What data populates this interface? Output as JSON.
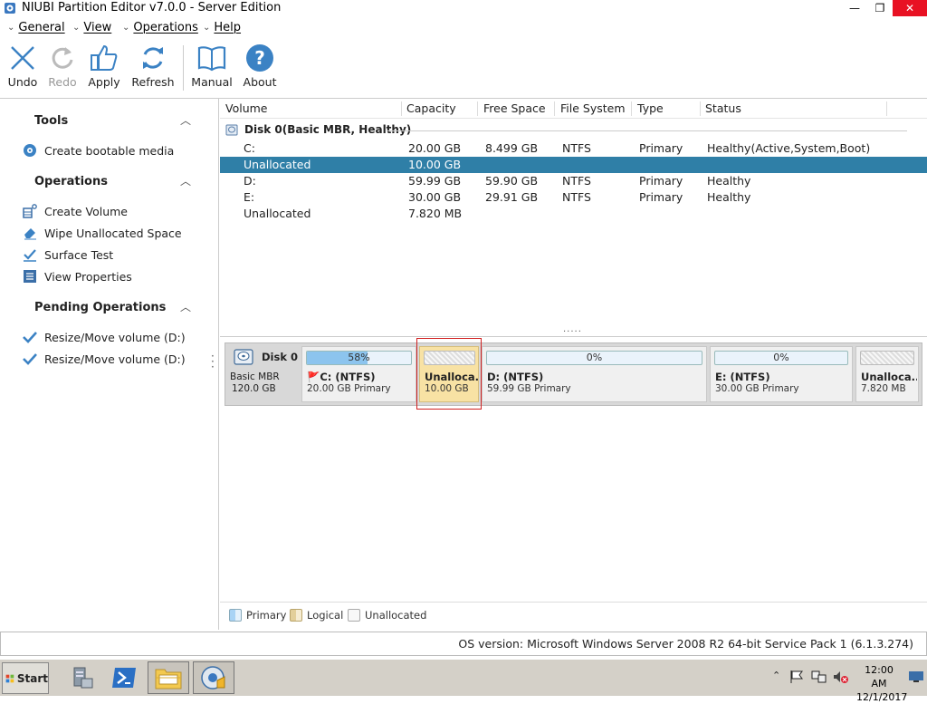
{
  "window": {
    "title": "NIUBI Partition Editor v7.0.0 - Server Edition",
    "min_glyph": "—",
    "max_glyph": "❐",
    "close_glyph": "✕"
  },
  "menu": [
    {
      "label": "General"
    },
    {
      "label": "View"
    },
    {
      "label": "Operations"
    },
    {
      "label": "Help"
    }
  ],
  "toolbar": {
    "undo": "Undo",
    "redo": "Redo",
    "apply": "Apply",
    "refresh": "Refresh",
    "manual": "Manual",
    "about": "About"
  },
  "sidebar": {
    "tools_title": "Tools",
    "tools": [
      {
        "label": "Create bootable media",
        "icon": "disc-icon"
      }
    ],
    "operations_title": "Operations",
    "operations": [
      {
        "label": "Create Volume",
        "icon": "create-volume-icon"
      },
      {
        "label": "Wipe Unallocated Space",
        "icon": "eraser-icon"
      },
      {
        "label": "Surface Test",
        "icon": "surface-test-icon"
      },
      {
        "label": "View Properties",
        "icon": "properties-icon"
      }
    ],
    "pending_title": "Pending Operations",
    "pending": [
      {
        "label": "Resize/Move volume (D:)",
        "icon": "check-icon"
      },
      {
        "label": "Resize/Move volume (D:)",
        "icon": "check-icon"
      }
    ]
  },
  "table": {
    "headers": {
      "volume": "Volume",
      "capacity": "Capacity",
      "free": "Free Space",
      "fs": "File System",
      "type": "Type",
      "status": "Status"
    },
    "disk_label": "Disk 0(Basic MBR, Healthy)",
    "rows": [
      {
        "volume": "C:",
        "capacity": "20.00 GB",
        "free": "8.499 GB",
        "fs": "NTFS",
        "type": "Primary",
        "status": "Healthy(Active,System,Boot)"
      },
      {
        "volume": "Unallocated",
        "capacity": "10.00 GB",
        "free": "",
        "fs": "",
        "type": "",
        "status": ""
      },
      {
        "volume": "D:",
        "capacity": "59.99 GB",
        "free": "59.90 GB",
        "fs": "NTFS",
        "type": "Primary",
        "status": "Healthy"
      },
      {
        "volume": "E:",
        "capacity": "30.00 GB",
        "free": "29.91 GB",
        "fs": "NTFS",
        "type": "Primary",
        "status": "Healthy"
      },
      {
        "volume": "Unallocated",
        "capacity": "7.820 MB",
        "free": "",
        "fs": "",
        "type": "",
        "status": ""
      }
    ],
    "selected_row": 1,
    "splitter": "....."
  },
  "diskmap": {
    "disk_name": "Disk 0",
    "disk_type": "Basic MBR",
    "disk_size": "120.0 GB",
    "partitions": [
      {
        "name": "C: (NTFS)",
        "info": "20.00 GB Primary",
        "pct": "58%",
        "used_fraction": 0.58,
        "kind": "primary",
        "flag": true
      },
      {
        "name": "Unalloca...",
        "info": "10.00 GB",
        "pct": "",
        "used_fraction": 0,
        "kind": "unallocated",
        "selected": true
      },
      {
        "name": "D: (NTFS)",
        "info": "59.99 GB Primary",
        "pct": "0%",
        "used_fraction": 0.0,
        "kind": "primary"
      },
      {
        "name": "E: (NTFS)",
        "info": "30.00 GB Primary",
        "pct": "0%",
        "used_fraction": 0.0,
        "kind": "primary"
      },
      {
        "name": "Unalloca...",
        "info": "7.820 MB",
        "pct": "",
        "used_fraction": 0,
        "kind": "unallocated"
      }
    ]
  },
  "legend": {
    "primary": "Primary",
    "logical": "Logical",
    "unallocated": "Unallocated"
  },
  "colors": {
    "primary": "#a9d3f5",
    "logical": "#e3cf9a",
    "selected_row": "#2f7fa7",
    "selected_part": "#f8e2a4"
  },
  "status": {
    "os_version": "OS version: Microsoft Windows Server 2008 R2  64-bit Service Pack 1 (6.1.3.274)"
  },
  "taskbar": {
    "start": "Start",
    "time": "12:00 AM",
    "date": "12/1/2017"
  }
}
